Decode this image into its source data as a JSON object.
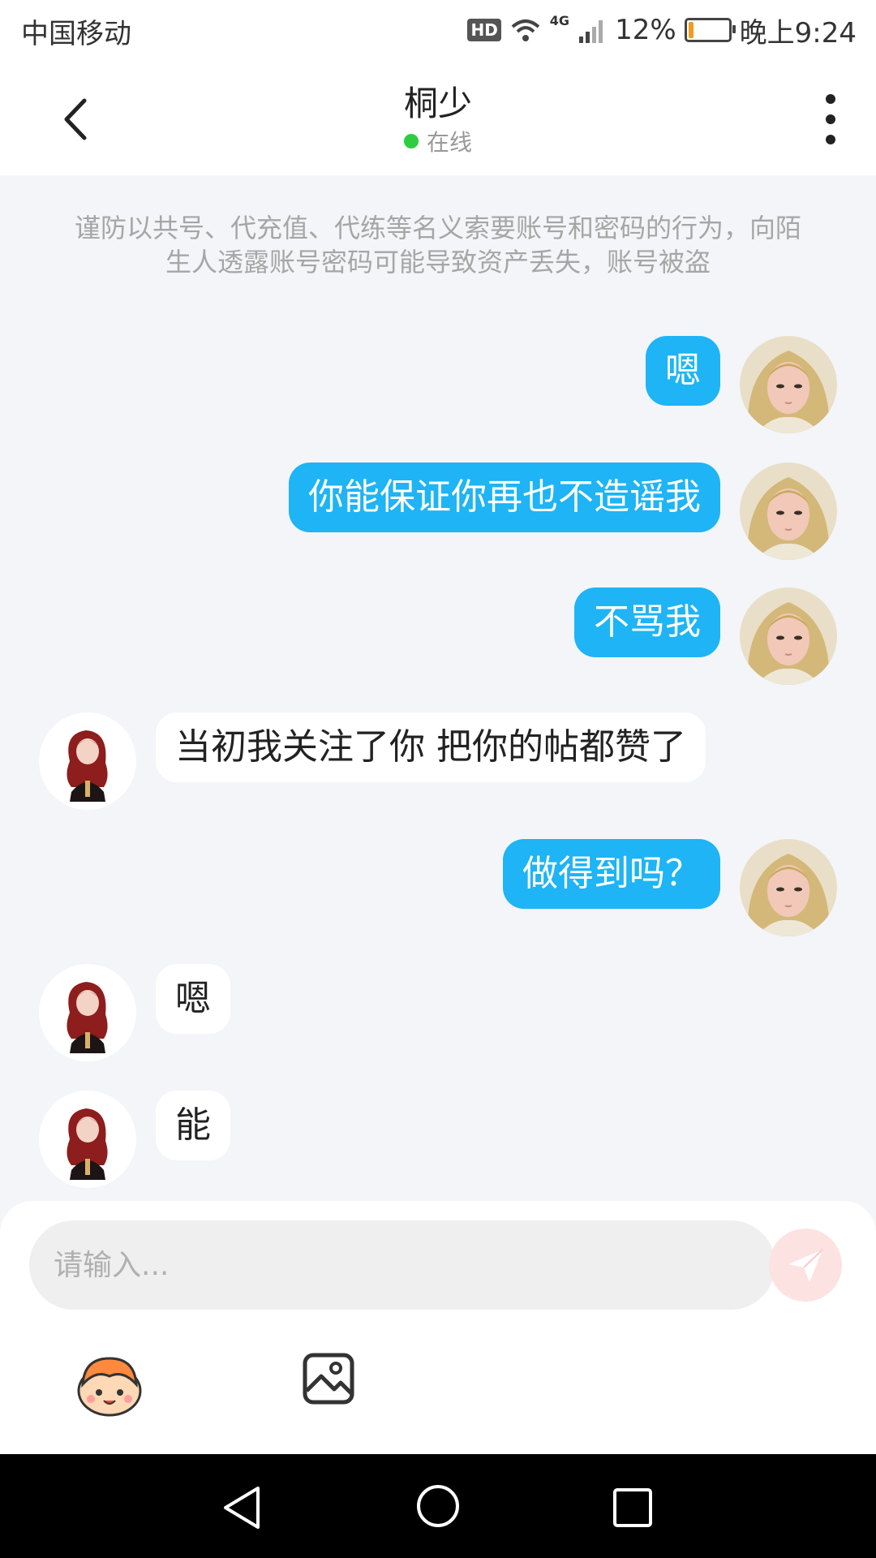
{
  "status_bar": {
    "carrier": "中国移动",
    "hd": "HD",
    "network": "4G",
    "battery_text": "12%",
    "battery_level": 0.12,
    "time": "晚上9:24"
  },
  "header": {
    "title": "桐少",
    "status": "在线",
    "status_color": "#2ecc40"
  },
  "warning": "谨防以共号、代充值、代练等名义索要账号和密码的行为，向陌生人透露账号密码可能导致资产丢失，账号被盗",
  "messages": [
    {
      "side": "right",
      "text": "嗯"
    },
    {
      "side": "right",
      "text": "你能保证你再也不造谣我"
    },
    {
      "side": "right",
      "text": "不骂我"
    },
    {
      "side": "left",
      "text": "当初我关注了你 把你的帖都赞了"
    },
    {
      "side": "right",
      "text": "做得到吗？"
    },
    {
      "side": "left",
      "text": "嗯"
    },
    {
      "side": "left",
      "text": "能"
    }
  ],
  "input": {
    "placeholder": "请输入..."
  },
  "colors": {
    "accent": "#1eb4f5",
    "send_button": "#fde2e2"
  },
  "icons": {
    "back": "chevron-left-icon",
    "more": "more-vertical-icon",
    "send": "paper-plane-icon",
    "emoji": "mascot-emoji-icon",
    "image": "image-icon"
  }
}
